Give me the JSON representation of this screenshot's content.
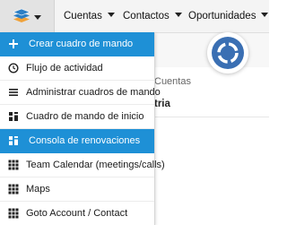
{
  "nav": {
    "items": [
      {
        "label": "Cuentas"
      },
      {
        "label": "Contactos"
      },
      {
        "label": "Oportunidades"
      }
    ]
  },
  "background": {
    "section_label": "Cuentas",
    "column_header": "tria"
  },
  "menu": {
    "items": [
      {
        "label": "Crear cuadro de mando",
        "icon": "plus-icon",
        "active": true
      },
      {
        "label": "Flujo de actividad",
        "icon": "clock-icon",
        "active": false
      },
      {
        "label": "Administrar cuadros de mando",
        "icon": "list-icon",
        "active": false
      },
      {
        "label": "Cuadro de mando de inicio",
        "icon": "dashboard-icon",
        "active": false
      },
      {
        "label": "Consola de renovaciones",
        "icon": "dashboard-icon",
        "active": true
      },
      {
        "label": "Team Calendar (meetings/calls)",
        "icon": "grid-icon",
        "active": false
      },
      {
        "label": "Maps",
        "icon": "grid-icon",
        "active": false
      },
      {
        "label": "Goto Account / Contact",
        "icon": "grid-icon",
        "active": false
      }
    ]
  },
  "colors": {
    "active_highlight": "#1e90d6",
    "logo_blue": "#2c7fc5",
    "logo_orange": "#f0a23a",
    "badge_blue": "#3a6fb3"
  }
}
